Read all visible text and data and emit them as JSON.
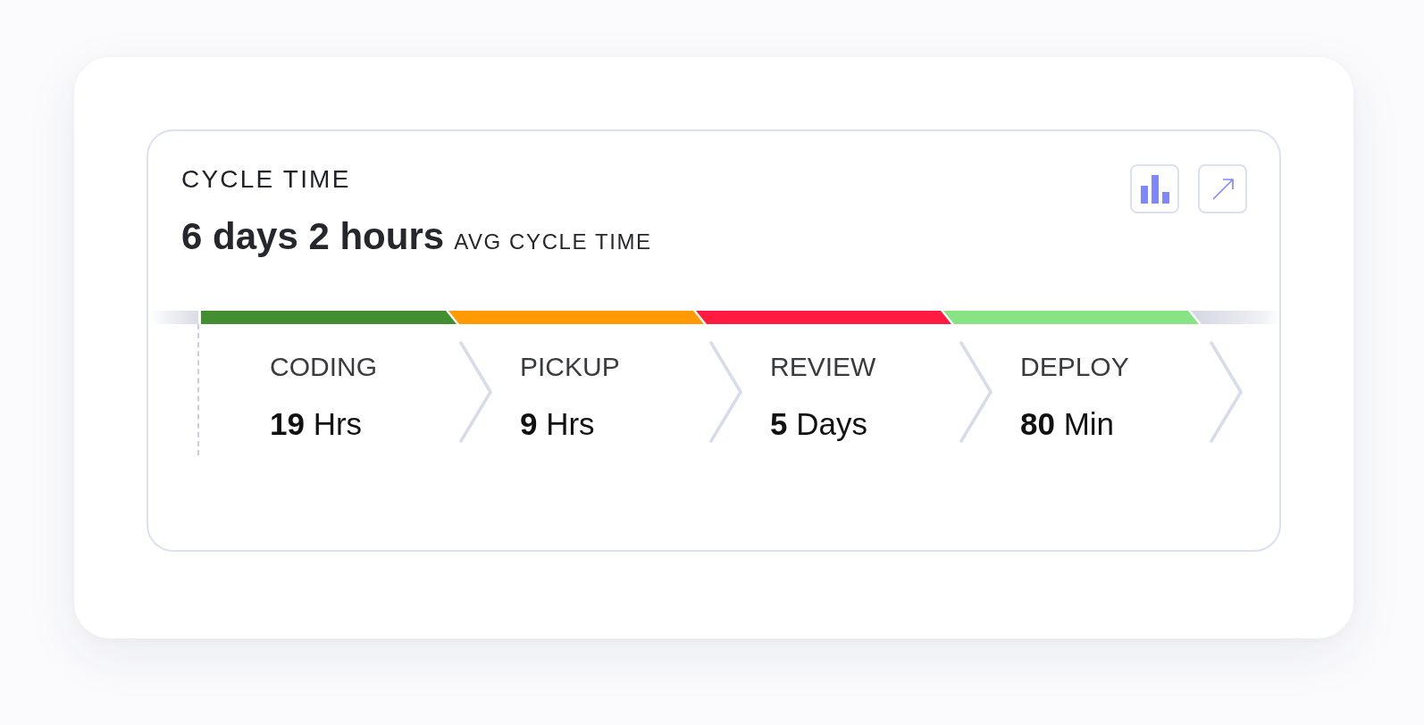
{
  "card": {
    "title": "CYCLE TIME",
    "average": {
      "value": "6 days 2 hours",
      "label": "AVG CYCLE TIME"
    }
  },
  "stages": [
    {
      "label": "CODING",
      "value": "**19** Hrs",
      "color": "#418f30"
    },
    {
      "label": "PICKUP",
      "value": "**9** Hrs",
      "color": "#ff9a05"
    },
    {
      "label": "REVIEW",
      "value": "**5** Days",
      "color": "#ff1a3f"
    },
    {
      "label": "DEPLOY",
      "value": "**80** Min",
      "color": "#88e384"
    }
  ]
}
